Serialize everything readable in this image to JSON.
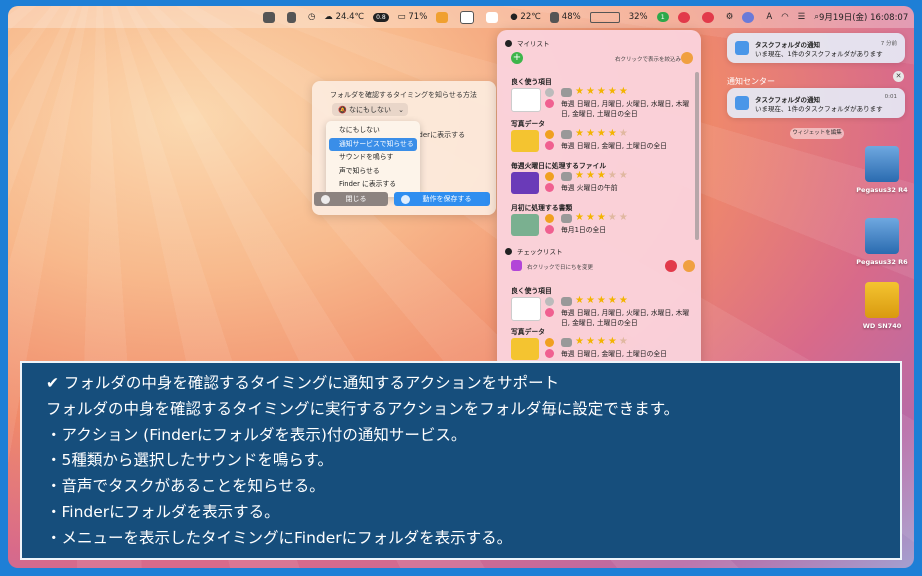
{
  "menubar": {
    "weather": "24.4℃",
    "badge": "0.8",
    "battery1": "71%",
    "temp2": "22℃",
    "cpu": "48%",
    "mem": "32%",
    "n1": "1",
    "clock": "9月19日(金) 16:08:07"
  },
  "popover": {
    "title": "フォルダを確認するタイミングを知らせる方法",
    "selected": "なにもしない",
    "finder_text": "nderに表示する",
    "options": [
      "なにもしない",
      "通知サービスで知らせる",
      "サウンドを鳴らす",
      "声で知らせる",
      "Finder に表示する"
    ],
    "close_label": "閉じる",
    "save_label": "動作を保存する"
  },
  "panel": {
    "mylist_title": "マイリスト",
    "mylist_hint": "右クリックで表示を絞込み",
    "checklist_title": "チェックリスト",
    "checklist_hint": "右クリックで日にちを変更",
    "items": [
      {
        "name": "良く使う項目",
        "sched": "毎週 日曜日, 月曜日, 火曜日, 水曜日, 木曜日, 金曜日, 土曜日の全日",
        "stars": 5,
        "thumb": "#ffffff"
      },
      {
        "name": "写真データ",
        "sched": "毎週 日曜日, 金曜日, 土曜日の全日",
        "stars": 4,
        "thumb": "#f4c430"
      },
      {
        "name": "毎週火曜日に処理するファイル",
        "sched": "毎週 火曜日の午前",
        "stars": 3,
        "thumb": "#6a3ab8"
      },
      {
        "name": "月初に処理する書類",
        "sched": "毎月1日の全日",
        "stars": 3,
        "thumb": "#7ab090"
      },
      {
        "name": "良く使う項目",
        "sched": "毎週 日曜日, 月曜日, 火曜日, 水曜日, 木曜日, 金曜日, 土曜日の全日",
        "stars": 5,
        "thumb": "#ffffff"
      },
      {
        "name": "写真データ",
        "sched": "毎週 日曜日, 金曜日, 土曜日の全日",
        "stars": 4,
        "thumb": "#f4c430"
      }
    ]
  },
  "notifications": {
    "top": {
      "title": "タスクフォルダの通知",
      "body": "いま現在、1件のタスクフォルダがあります",
      "time": "7 分前"
    },
    "center_title": "通知センター",
    "center": {
      "title": "タスクフォルダの通知",
      "body": "いま現在、1件のタスクフォルダがあります",
      "time": "0:01"
    },
    "widget_button": "ウィジェットを編集"
  },
  "drives": [
    "Pegasus32 R4",
    "Pegasus32 R6",
    "WD SN740"
  ],
  "caption": [
    "✔ フォルダの中身を確認するタイミングに通知するアクションをサポート",
    "フォルダの中身を確認するタイミングに実行するアクションをフォルダ毎に設定できます。",
    "・アクション (Finderにフォルダを表示)付の通知サービス。",
    "・5種類から選択したサウンドを鳴らす。",
    "・音声でタスクがあることを知らせる。",
    "・Finderにフォルダを表示する。",
    "・メニューを表示したタイミングにFinderにフォルダを表示する。"
  ]
}
